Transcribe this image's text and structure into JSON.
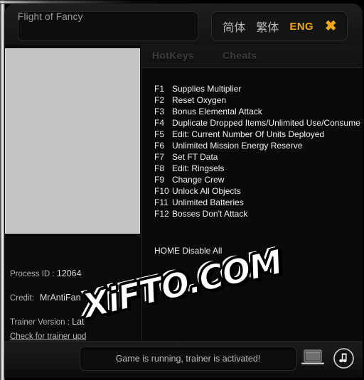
{
  "window": {
    "game_title": "Flight of Fancy",
    "game_title_placeholder": "Flight of Fancy"
  },
  "language_bar": {
    "simplified_label": "简体",
    "traditional_label": "繁体",
    "english_label": "ENG",
    "active": "ENG",
    "close_label": "✖",
    "accent_color": "#f0a81a"
  },
  "tabs": [
    {
      "label": "HotKeys",
      "active": false
    },
    {
      "label": "Cheats",
      "active": false
    }
  ],
  "cover": {
    "placeholder_color": "#c4c4c4"
  },
  "info": {
    "process_id_label": "Process ID : ",
    "process_id_value": "12064",
    "credit_label": "Credit:",
    "credit_value": "MrAntiFan",
    "trainer_version_label": "Trainer Version : ",
    "trainer_version_value": "Lat",
    "update_link": "Check for trainer upd"
  },
  "cheats": [
    {
      "key": "F1",
      "label": "Supplies Multiplier"
    },
    {
      "key": "F2",
      "label": "Reset Oxygen"
    },
    {
      "key": "F3",
      "label": "Bonus Elemental Attack"
    },
    {
      "key": "F4",
      "label": "Duplicate Dropped Items/Unlimited Use/Consume"
    },
    {
      "key": "F5",
      "label": "Edit: Current Number Of Units Deployed"
    },
    {
      "key": "F6",
      "label": "Unlimited Mission Energy Reserve"
    },
    {
      "key": "F7",
      "label": "Set FT Data"
    },
    {
      "key": "F8",
      "label": "Edit: Ringsels"
    },
    {
      "key": "F9",
      "label": "Change Crew"
    },
    {
      "key": "F10",
      "label": "Unlock All Objects"
    },
    {
      "key": "F11",
      "label": "Unlimited Batteries"
    },
    {
      "key": "F12",
      "label": "Bosses Don't Attack"
    }
  ],
  "disable_all": "HOME Disable All",
  "status": {
    "message": "Game is running, trainer is activated!"
  },
  "icons": {
    "laptop": "laptop-icon",
    "music": "music-note-icon"
  },
  "watermark": {
    "text": "XiFTO.COM"
  }
}
